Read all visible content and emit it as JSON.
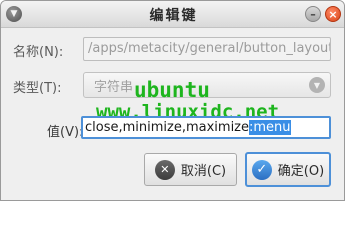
{
  "window": {
    "title": "编辑键",
    "menu_icon": "window-menu-icon",
    "minimize_icon": "minimize-icon",
    "close_icon": "close-icon"
  },
  "form": {
    "name_label": "名称(N):",
    "name_value": "/apps/metacity/general/button_layout",
    "type_label": "类型(T):",
    "type_value": "字符串",
    "value_label": "值(V):",
    "value_text_unselected": "close,minimize,maximize",
    "value_text_selected": ":menu"
  },
  "watermark": {
    "line1": "ubuntu",
    "line2": "www.linuxidc.net"
  },
  "buttons": {
    "cancel_label": "取消(C)",
    "ok_label": "确定(O)"
  },
  "colors": {
    "accent": "#4d90d8",
    "selection": "#3a8ee6",
    "watermark": "#1eb51e",
    "close_button": "#d94316"
  }
}
